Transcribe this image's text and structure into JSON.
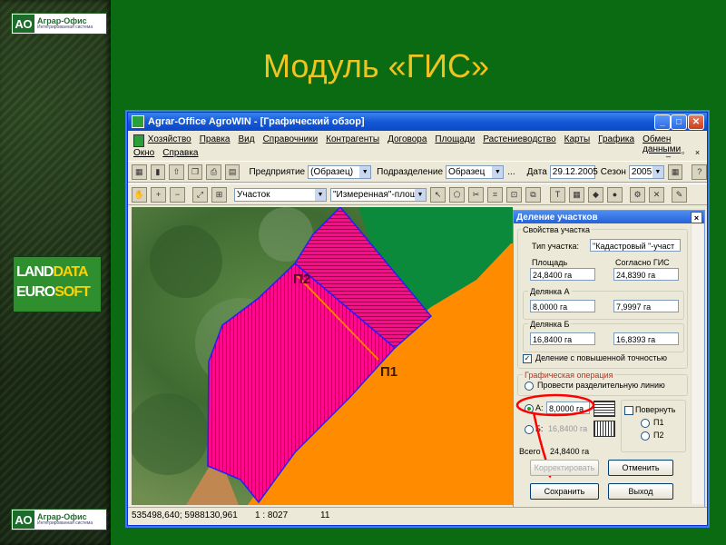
{
  "slide": {
    "title": "Модуль «ГИС»",
    "logo_top": {
      "mark": "АО",
      "name": "Аграр-Офис",
      "tagline": "Интегрированная система"
    },
    "logo_bottom": {
      "mark": "АО",
      "name": "Аграр-Офис",
      "tagline": "Интегрированная система"
    },
    "landdata": {
      "line1_a": "LAND",
      "line1_b": "DATA",
      "line2_a": "EURO",
      "line2_b": "SOFT"
    }
  },
  "window": {
    "title": "Agrar-Office AgroWIN  - [Графический обзор]",
    "min": "_",
    "max": "□",
    "close": "✕"
  },
  "menu": {
    "row1": [
      "Хозяйство",
      "Правка",
      "Вид",
      "Справочники",
      "Контрагенты",
      "Договора",
      "Площади",
      "Растениеводство",
      "Карты",
      "Графика",
      "Обмен данными"
    ],
    "row2": [
      "Окно",
      "Справка"
    ],
    "mdi": [
      "_",
      "▫",
      "×"
    ]
  },
  "toolbar1": {
    "enterprise_label": "Предприятие",
    "enterprise_value": "(Образец)",
    "division_label": "Подразделение",
    "division_value": "Образец",
    "more": "...",
    "date_label": "Дата",
    "date_value": "29.12.2005",
    "season_label": "Сезон",
    "season_value": "2005"
  },
  "toolbar2": {
    "layer_value": "Участок",
    "measure_value": "\"Измеренная\"-площ"
  },
  "map": {
    "label_p1": "П1",
    "label_p2": "П2",
    "colors": {
      "field": "#ff0a8c",
      "orange": "#ff8c00",
      "green": "#0a8a3a",
      "aerial": "#4d7a3a",
      "brown": "#c08850"
    }
  },
  "status": {
    "coords": "535498,640; 5988130,961",
    "scale": "1 :   8027",
    "num": "11"
  },
  "dialog": {
    "title": "Деление участков",
    "close": "×",
    "props_group": "Свойства участка",
    "type_label": "Тип участка:",
    "type_value": "\"Кадастровый \"-участ",
    "area_label": "Площадь",
    "gis_label": "Согласно ГИС",
    "area_value": "24,8400 га",
    "gis_value": "24,8390 га",
    "plotA_label": "Делянка А",
    "plotA_value": "8,0000 га",
    "plotA_gis": "7,9997 га",
    "plotB_label": "Делянка Б",
    "plotB_value": "16,8400 га",
    "plotB_gis": "16,8393 га",
    "precision_label": "Деление с повышенной точностью",
    "precision_check": "✓",
    "graph_op_label": "Графическая операция",
    "draw_line_label": "Провести разделительную линию",
    "radioA_label": "А:",
    "radioA_value": "8,0000 га",
    "radioB_label": "Б:",
    "radioB_value": "16,8400 га",
    "rotate_label": "Повернуть",
    "p1_label": "П1",
    "p2_label": "П2",
    "total_label": "Всего",
    "total_value": "24,8400 га",
    "btn_correct": "Корректировать",
    "btn_cancel": "Отменить",
    "btn_save": "Сохранить",
    "btn_exit": "Выход",
    "highlight_color": "#ff0000"
  }
}
